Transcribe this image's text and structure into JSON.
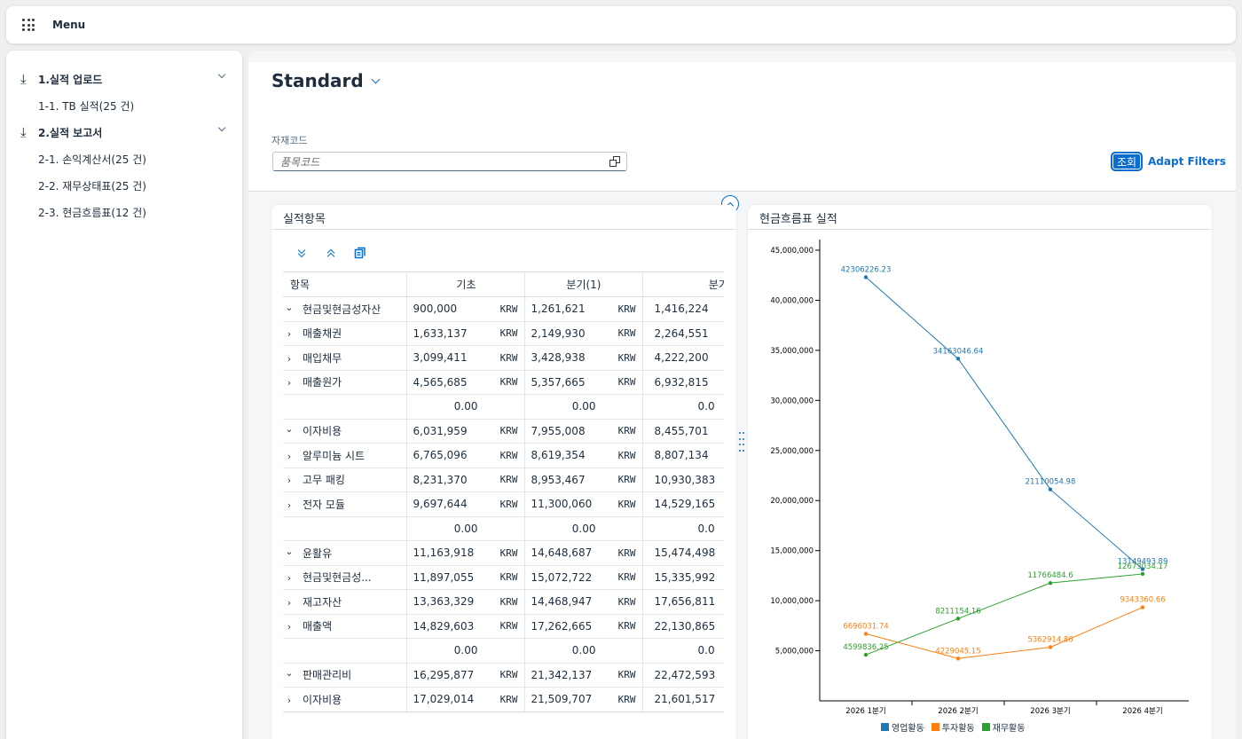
{
  "topbar": {
    "menu_label": "Menu"
  },
  "sidebar": {
    "groups": [
      {
        "label": "1.실적 업로드",
        "items": [
          "1-1. TB 실적(25 건)"
        ]
      },
      {
        "label": "2.실적 보고서",
        "items": [
          "2-1. 손익계산서(25 건)",
          "2-2. 재무상태표(25 건)",
          "2-3. 현금흐름표(12 건)"
        ]
      }
    ]
  },
  "header": {
    "variant_title": "Standard",
    "filter_label": "자재코드",
    "filter_placeholder": "품목코드",
    "go_label": "조회",
    "adapt_label": "Adapt Filters"
  },
  "table_panel": {
    "title": "실적항목",
    "columns": [
      "항목",
      "기초",
      "분기(1)",
      "분기("
    ],
    "rows": [
      {
        "name": "현금및현금성자산",
        "level": 0,
        "toggle": "expanded",
        "v": [
          "900,000",
          "1,261,621",
          "1,416,224"
        ],
        "cur": "KRW"
      },
      {
        "name": "매출채권",
        "level": 1,
        "toggle": "collapsed",
        "v": [
          "1,633,137",
          "2,149,930",
          "2,264,551"
        ],
        "cur": "KRW"
      },
      {
        "name": "매입채무",
        "level": 1,
        "toggle": "collapsed",
        "v": [
          "3,099,411",
          "3,428,938",
          "4,222,200"
        ],
        "cur": "KRW"
      },
      {
        "name": "매출원가",
        "level": 1,
        "toggle": "collapsed",
        "v": [
          "4,565,685",
          "5,357,665",
          "6,932,815"
        ],
        "cur": "KRW"
      },
      {
        "name": "",
        "level": 0,
        "toggle": "none",
        "v": [
          "0.00",
          "0.00",
          "0.0"
        ],
        "cur": ""
      },
      {
        "name": "이자비용",
        "level": 0,
        "toggle": "expanded",
        "v": [
          "6,031,959",
          "7,955,008",
          "8,455,701"
        ],
        "cur": "KRW"
      },
      {
        "name": "알루미늄 시트",
        "level": 1,
        "toggle": "collapsed",
        "v": [
          "6,765,096",
          "8,619,354",
          "8,807,134"
        ],
        "cur": "KRW"
      },
      {
        "name": "고무 패킹",
        "level": 1,
        "toggle": "collapsed",
        "v": [
          "8,231,370",
          "8,953,467",
          "10,930,383"
        ],
        "cur": "KRW"
      },
      {
        "name": "전자 모듈",
        "level": 1,
        "toggle": "collapsed",
        "v": [
          "9,697,644",
          "11,300,060",
          "14,529,165"
        ],
        "cur": "KRW"
      },
      {
        "name": "",
        "level": 0,
        "toggle": "none",
        "v": [
          "0.00",
          "0.00",
          "0.0"
        ],
        "cur": ""
      },
      {
        "name": "윤활유",
        "level": 0,
        "toggle": "expanded",
        "v": [
          "11,163,918",
          "14,648,687",
          "15,474,498"
        ],
        "cur": "KRW"
      },
      {
        "name": "현금및현금성...",
        "level": 1,
        "toggle": "collapsed",
        "v": [
          "11,897,055",
          "15,072,722",
          "15,335,992"
        ],
        "cur": "KRW"
      },
      {
        "name": "재고자산",
        "level": 1,
        "toggle": "collapsed",
        "v": [
          "13,363,329",
          "14,468,947",
          "17,656,811"
        ],
        "cur": "KRW"
      },
      {
        "name": "매출액",
        "level": 1,
        "toggle": "collapsed",
        "v": [
          "14,829,603",
          "17,262,665",
          "22,130,865"
        ],
        "cur": "KRW"
      },
      {
        "name": "",
        "level": 0,
        "toggle": "none",
        "v": [
          "0.00",
          "0.00",
          "0.0"
        ],
        "cur": ""
      },
      {
        "name": "판매관리비",
        "level": 0,
        "toggle": "expanded",
        "v": [
          "16,295,877",
          "21,342,137",
          "22,472,593"
        ],
        "cur": "KRW"
      },
      {
        "name": "이자비용",
        "level": 1,
        "toggle": "collapsed",
        "v": [
          "17,029,014",
          "21,509,707",
          "21,601,517"
        ],
        "cur": "KRW"
      }
    ]
  },
  "chart_panel": {
    "title": "현금흐름표 실적"
  },
  "chart_data": {
    "type": "line",
    "title": "",
    "xlabel": "",
    "ylabel": "",
    "categories": [
      "2026 1분기",
      "2026 2분기",
      "2026 3분기",
      "2026 4분기"
    ],
    "ylim": [
      0,
      45000000
    ],
    "yticks": [
      "5,000,000",
      "10,000,000",
      "15,000,000",
      "20,000,000",
      "25,000,000",
      "30,000,000",
      "35,000,000",
      "40,000,000",
      "45,000,000"
    ],
    "series": [
      {
        "name": "영업활동",
        "color": "#1f77b4",
        "values": [
          42306226.23,
          34163046.64,
          21110054.98,
          13149493.89
        ],
        "labels": [
          "42306226.23",
          "34163046.64",
          "21110054.98",
          "13149493.89"
        ]
      },
      {
        "name": "투자활동",
        "color": "#ff7f0e",
        "values": [
          6696031.74,
          4229045.15,
          5362914.86,
          9343360.66
        ],
        "labels": [
          "6696031.74",
          "4229045.15",
          "5362914.86",
          "9343360.66"
        ]
      },
      {
        "name": "재무활동",
        "color": "#2ca02c",
        "values": [
          4599836.25,
          8211154.16,
          11766484.6,
          12673034.17
        ],
        "labels": [
          "4599836.25",
          "8211154.16",
          "11766484.6",
          "12673034.17"
        ]
      }
    ],
    "legend": "bottom"
  }
}
